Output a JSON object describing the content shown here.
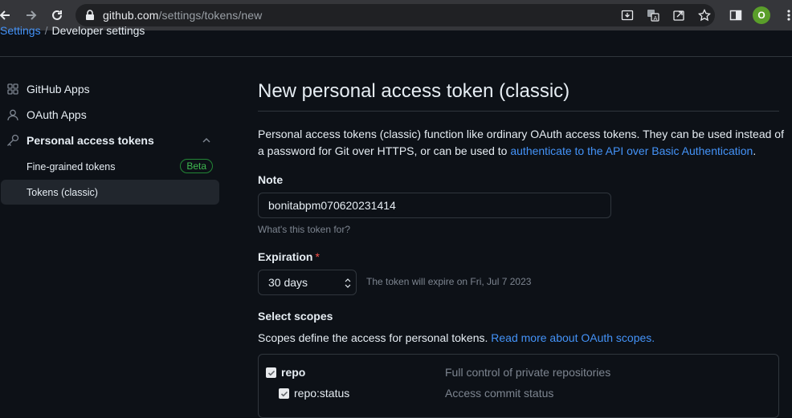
{
  "browser": {
    "url_host": "github.com",
    "url_path": "/settings/tokens/new",
    "profile_initial": "O"
  },
  "breadcrumb": {
    "parent": "Settings",
    "separator": "/",
    "current": "Developer settings"
  },
  "sidebar": {
    "items": [
      {
        "label": "GitHub Apps",
        "icon": "apps-grid-icon"
      },
      {
        "label": "OAuth Apps",
        "icon": "person-icon"
      },
      {
        "label": "Personal access tokens",
        "icon": "key-icon"
      }
    ],
    "subitems": [
      {
        "label": "Fine-grained tokens",
        "badge": "Beta"
      },
      {
        "label": "Tokens (classic)"
      }
    ]
  },
  "main": {
    "title": "New personal access token (classic)",
    "description_text": "Personal access tokens (classic) function like ordinary OAuth access tokens. They can be used instead of a password for Git over HTTPS, or can be used to ",
    "description_link": "authenticate to the API over Basic Authentication",
    "description_end": ".",
    "note_label": "Note",
    "note_value": "bonitabpm070620231414",
    "note_hint": "What's this token for?",
    "expiration_label": "Expiration",
    "required_mark": "*",
    "expiration_value": "30 days",
    "expiration_note": "The token will expire on Fri, Jul 7 2023",
    "scopes_label": "Select scopes",
    "scopes_desc": "Scopes define the access for personal tokens. ",
    "scopes_link": "Read more about OAuth scopes."
  },
  "scopes": [
    {
      "name": "repo",
      "description": "Full control of private repositories",
      "checked": true
    },
    {
      "name": "repo:status",
      "description": "Access commit status",
      "checked": true
    }
  ],
  "colors": {
    "background": "#0d1117",
    "link": "#4493f8",
    "beta": "#3fb950",
    "required": "#f85149"
  }
}
